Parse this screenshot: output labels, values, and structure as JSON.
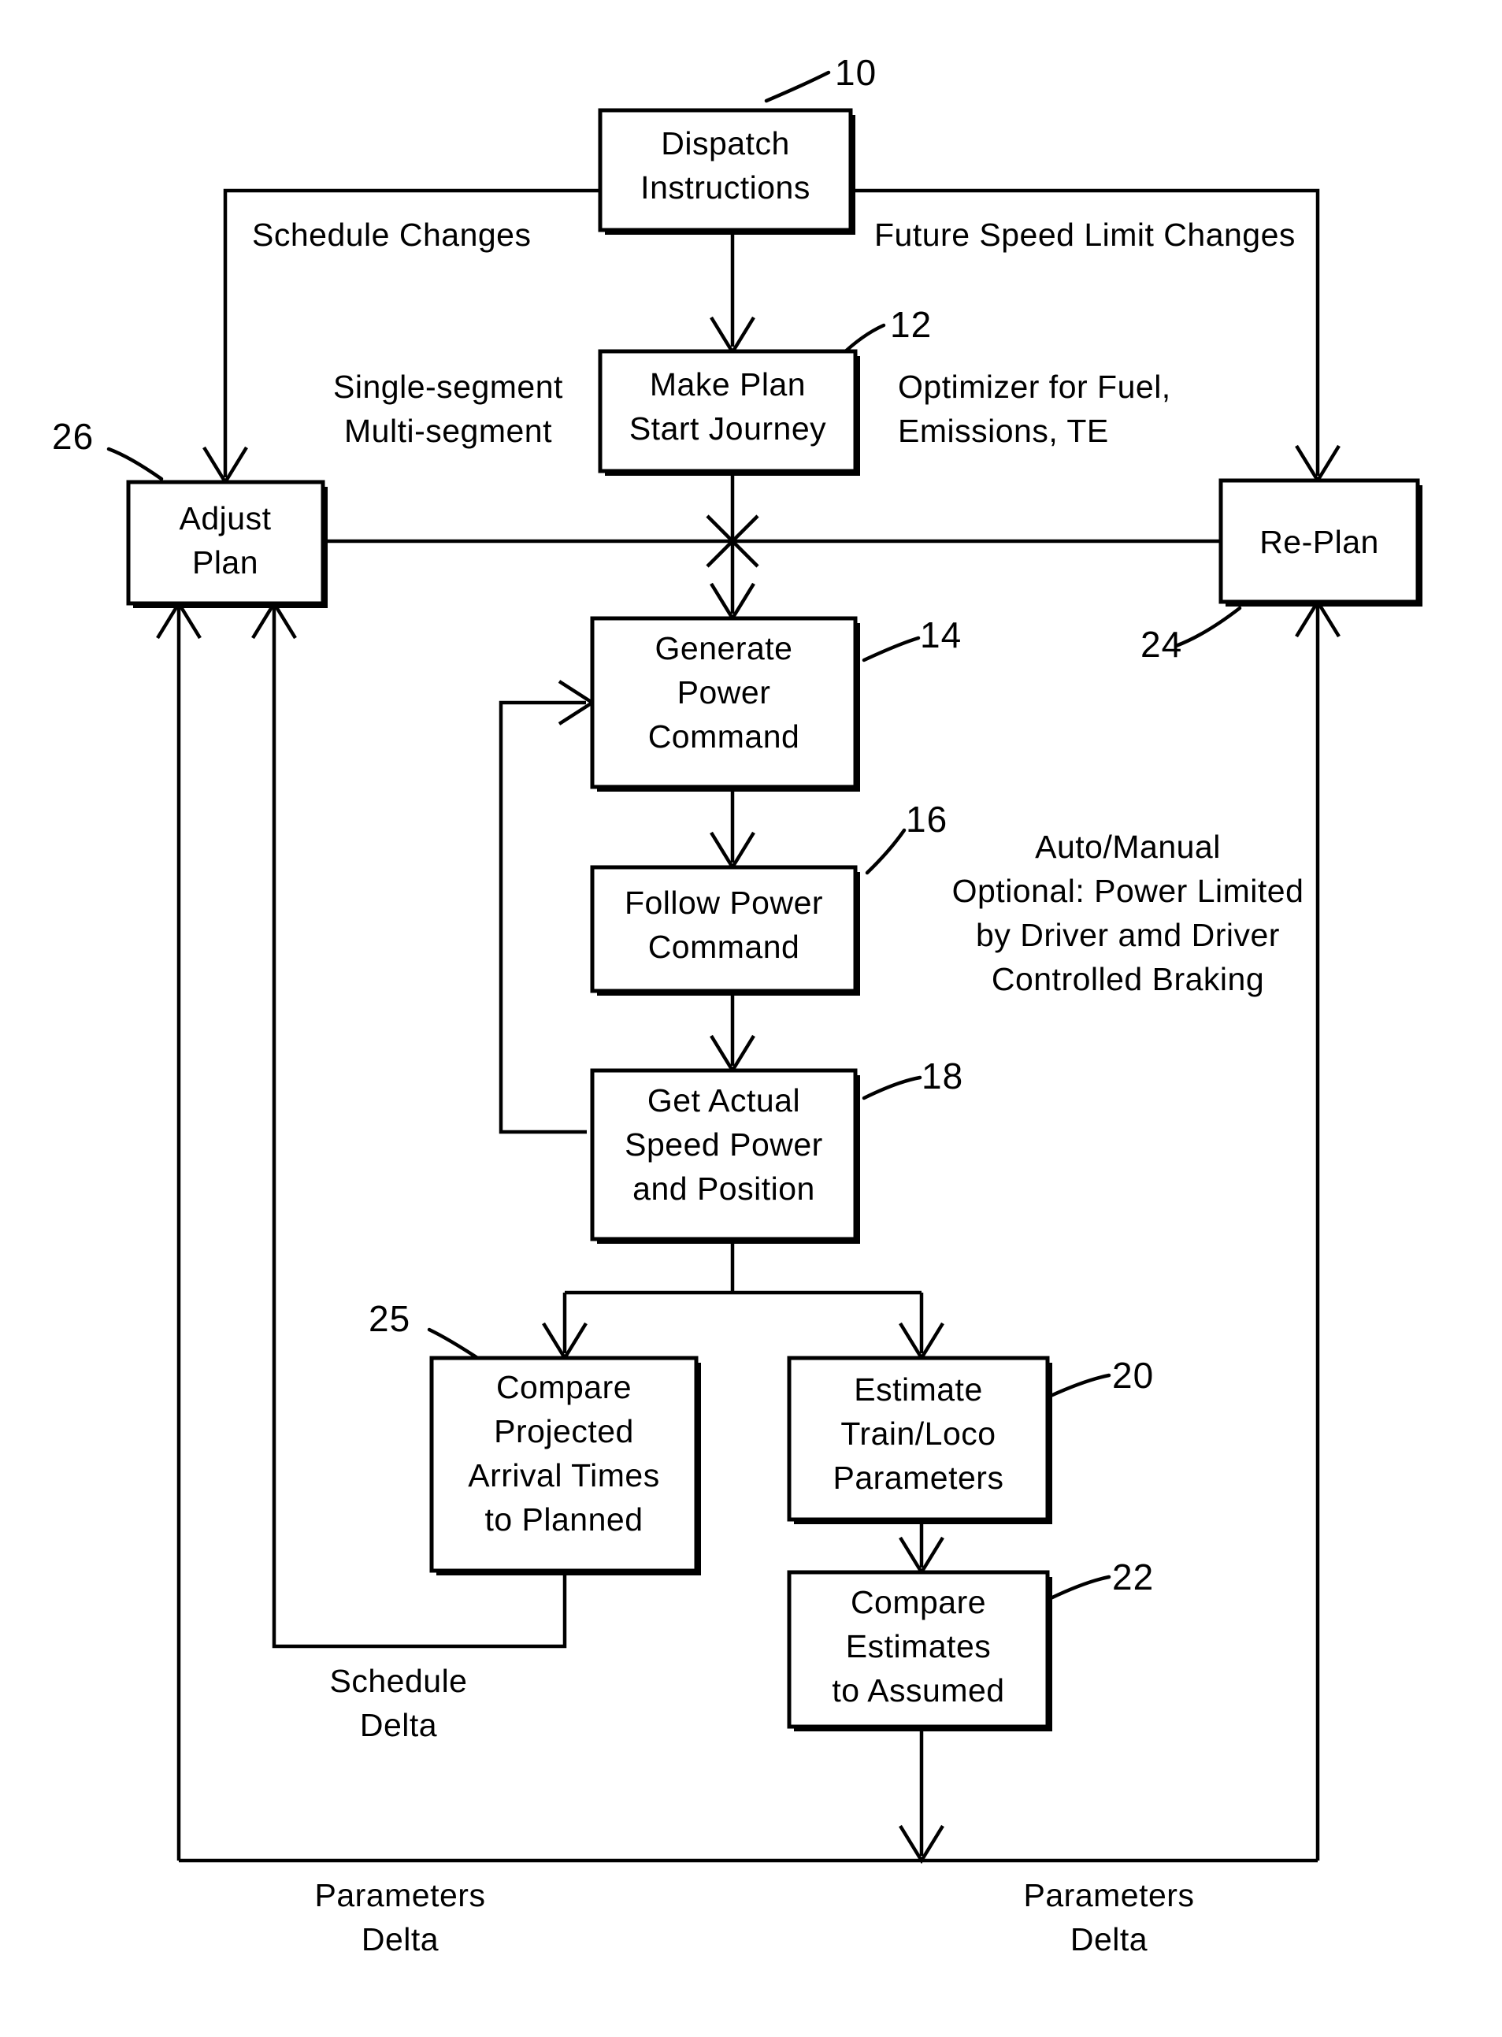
{
  "figure": {
    "type": "patent-flowchart",
    "title": "Train journey planning and re-planning control flow",
    "background_color": "#ffffff",
    "line_color": "#000000"
  },
  "boxes": [
    {
      "id": "dispatch",
      "ref": "10",
      "lines": [
        "Dispatch",
        "Instructions"
      ]
    },
    {
      "id": "make_plan",
      "ref": "12",
      "lines": [
        "Make Plan",
        "Start Journey"
      ]
    },
    {
      "id": "adjust_plan",
      "ref": "26",
      "lines": [
        "Adjust",
        "Plan"
      ]
    },
    {
      "id": "replan",
      "ref": "24",
      "lines": [
        "Re-Plan"
      ]
    },
    {
      "id": "generate_power",
      "ref": "14",
      "lines": [
        "Generate",
        "Power",
        "Command"
      ]
    },
    {
      "id": "follow_power",
      "ref": "16",
      "lines": [
        "Follow Power",
        "Command"
      ]
    },
    {
      "id": "get_actual",
      "ref": "18",
      "lines": [
        "Get Actual",
        "Speed Power",
        "and Position"
      ]
    },
    {
      "id": "compare_arrival",
      "ref": "25",
      "lines": [
        "Compare",
        "Projected",
        "Arrival Times",
        "to Planned"
      ]
    },
    {
      "id": "estimate_params",
      "ref": "20",
      "lines": [
        "Estimate",
        "Train/Loco",
        "Parameters"
      ]
    },
    {
      "id": "compare_est",
      "ref": "22",
      "lines": [
        "Compare",
        "Estimates",
        "to Assumed"
      ]
    }
  ],
  "annotations": [
    {
      "id": "schedule_changes",
      "lines": [
        "Schedule Changes"
      ]
    },
    {
      "id": "future_speed_limit",
      "lines": [
        "Future Speed Limit Changes"
      ]
    },
    {
      "id": "segment_mode",
      "lines": [
        "Single-segment",
        "Multi-segment"
      ]
    },
    {
      "id": "optimizer",
      "lines": [
        "Optimizer for Fuel,",
        "Emissions, TE"
      ]
    },
    {
      "id": "auto_manual",
      "lines": [
        "Auto/Manual",
        "Optional: Power Limited",
        "by Driver amd Driver",
        "Controlled Braking"
      ]
    },
    {
      "id": "schedule_delta",
      "lines": [
        "Schedule",
        "Delta"
      ]
    },
    {
      "id": "parameters_delta_left",
      "lines": [
        "Parameters",
        "Delta"
      ]
    },
    {
      "id": "parameters_delta_right",
      "lines": [
        "Parameters",
        "Delta"
      ]
    }
  ],
  "reference_numerals": [
    "10",
    "12",
    "14",
    "16",
    "18",
    "20",
    "22",
    "24",
    "25",
    "26"
  ]
}
